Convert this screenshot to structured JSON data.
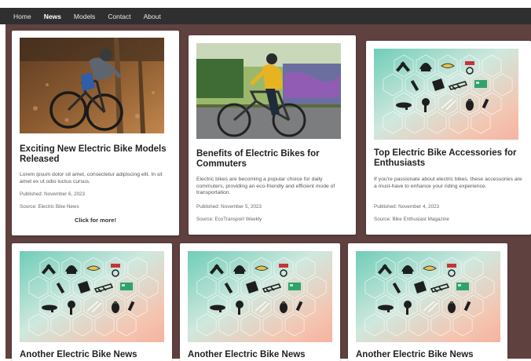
{
  "nav": {
    "items": [
      "Home",
      "News",
      "Models",
      "Contact",
      "About"
    ],
    "active": "News"
  },
  "cards": [
    {
      "title": "Exciting New Electric Bike Models Released",
      "description": "Lorem ipsum dolor sit amet, consectetur adipiscing elit. In sit amet ex ut odio luctus cursus.",
      "published": "Published: November 6, 2023",
      "source": "Source: Electric Bike News",
      "cta": "Click for more!"
    },
    {
      "title": "Benefits of Electric Bikes for Commuters",
      "description": "Electric bikes are becoming a popular choice for daily commuters, providing an eco-friendly and efficient mode of transportation.",
      "published": "Published: November 5, 2023",
      "source": "Source: EcoTransport Weekly"
    },
    {
      "title": "Top Electric Bike Accessories for Enthusiasts",
      "description": "If you're passionate about electric bikes, these accessories are a must-have to enhance your riding experience.",
      "published": "Published: November 4, 2023",
      "source": "Source: Bike Enthusiast Magazine"
    },
    {
      "title": "Another Electric Bike News"
    },
    {
      "title": "Another Electric Bike News"
    },
    {
      "title": "Another Electric Bike News"
    }
  ],
  "icons": {
    "card1_image": "mountain-bike-rider-photo",
    "card2_image": "commuter-cyclist-photo",
    "accessory_image": "bike-accessories-hex-grid"
  },
  "colors": {
    "nav_bg": "#2f2f2f",
    "page_bg": "#5f4140",
    "card_bg": "#ffffff"
  }
}
